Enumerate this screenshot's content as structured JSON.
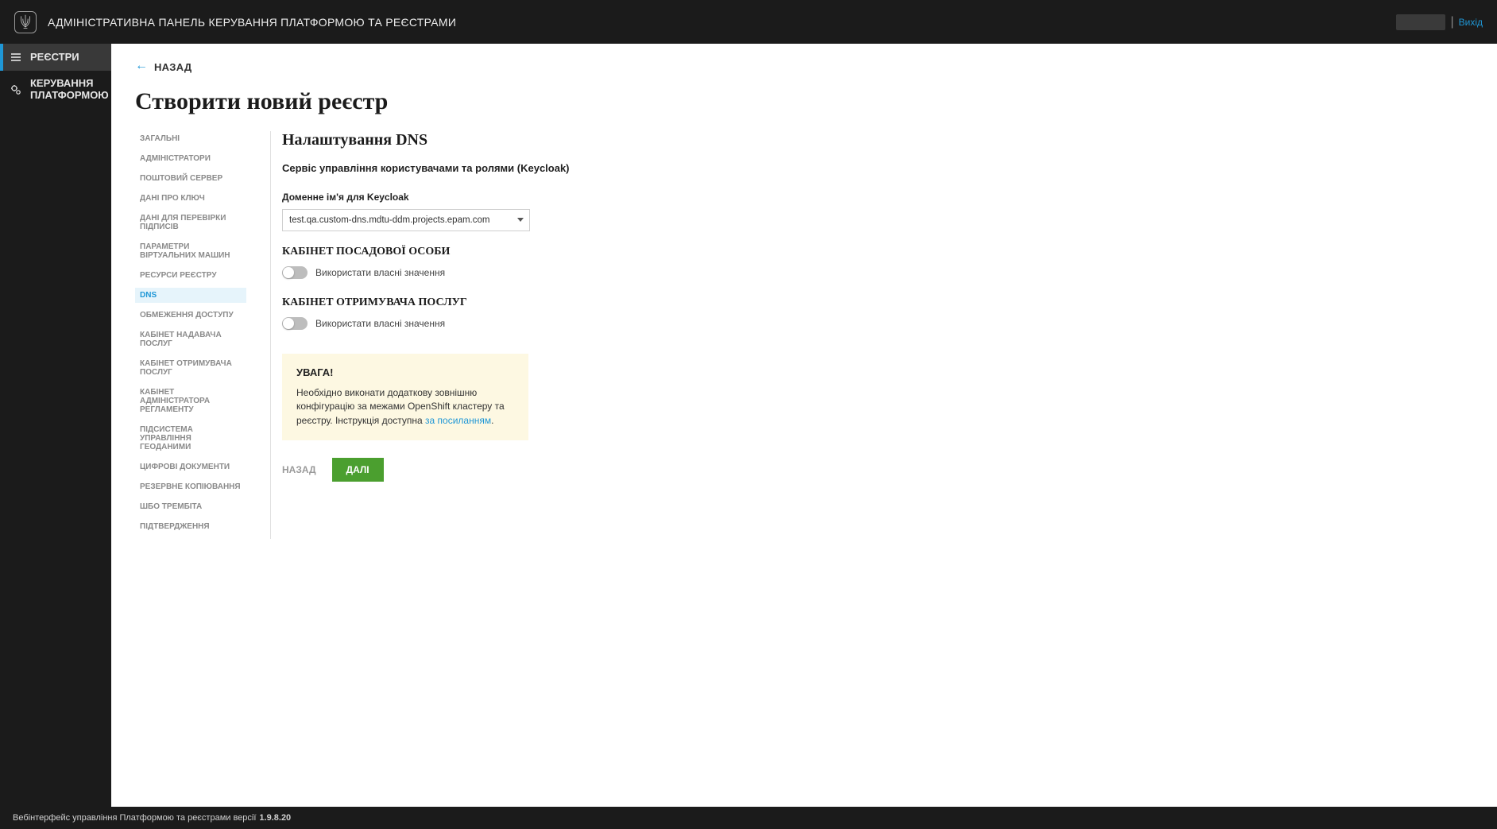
{
  "header": {
    "app_title": "АДМІНІСТРАТИВНА ПАНЕЛЬ КЕРУВАННЯ ПЛАТФОРМОЮ ТА РЕЄСТРАМИ",
    "logout": "Вихід"
  },
  "sidebar": {
    "items": [
      {
        "label": "РЕЄСТРИ"
      },
      {
        "label": "КЕРУВАННЯ ПЛАТФОРМОЮ"
      }
    ]
  },
  "main": {
    "back": "НАЗАД",
    "page_title": "Створити новий реєстр"
  },
  "steps": [
    "ЗАГАЛЬНІ",
    "АДМІНІСТРАТОРИ",
    "ПОШТОВИЙ СЕРВЕР",
    "ДАНІ ПРО КЛЮЧ",
    "ДАНІ ДЛЯ ПЕРЕВІРКИ ПІДПИСІВ",
    "ПАРАМЕТРИ ВІРТУАЛЬНИХ МАШИН",
    "РЕСУРСИ РЕЄСТРУ",
    "DNS",
    "ОБМЕЖЕННЯ ДОСТУПУ",
    "КАБІНЕТ НАДАВАЧА ПОСЛУГ",
    "КАБІНЕТ ОТРИМУВАЧА ПОСЛУГ",
    "КАБІНЕТ АДМІНІСТРАТОРА РЕГЛАМЕНТУ",
    "ПІДСИСТЕМА УПРАВЛІННЯ ГЕОДАНИМИ",
    "ЦИФРОВІ ДОКУМЕНТИ",
    "РЕЗЕРВНЕ КОПІЮВАННЯ",
    "ШБО ТРЕМБІТА",
    "ПІДТВЕРДЖЕННЯ"
  ],
  "form": {
    "section_title": "Налаштування DNS",
    "sub_title": "Сервіс управління користувачами та ролями (Keycloak)",
    "domain_label": "Доменне ім'я для Keycloak",
    "domain_value": "test.qa.custom-dns.mdtu-ddm.projects.epam.com",
    "group1_title": "КАБІНЕТ ПОСАДОВОЇ ОСОБИ",
    "group1_toggle_label": "Використати власні значення",
    "group2_title": "КАБІНЕТ ОТРИМУВАЧА ПОСЛУГ",
    "group2_toggle_label": "Використати власні значення",
    "notice_title": "УВАГА!",
    "notice_text_1": "Необхідно виконати додаткову зовнішню конфігурацію за межами OpenShift кластеру та реєстру. Інструкція доступна ",
    "notice_link": "за посиланням",
    "notice_text_2": ".",
    "btn_back": "НАЗАД",
    "btn_next": "ДАЛІ"
  },
  "footer": {
    "text": "Вебінтерфейс управління Платформою та реєстрами версії ",
    "version": "1.9.8.20"
  }
}
